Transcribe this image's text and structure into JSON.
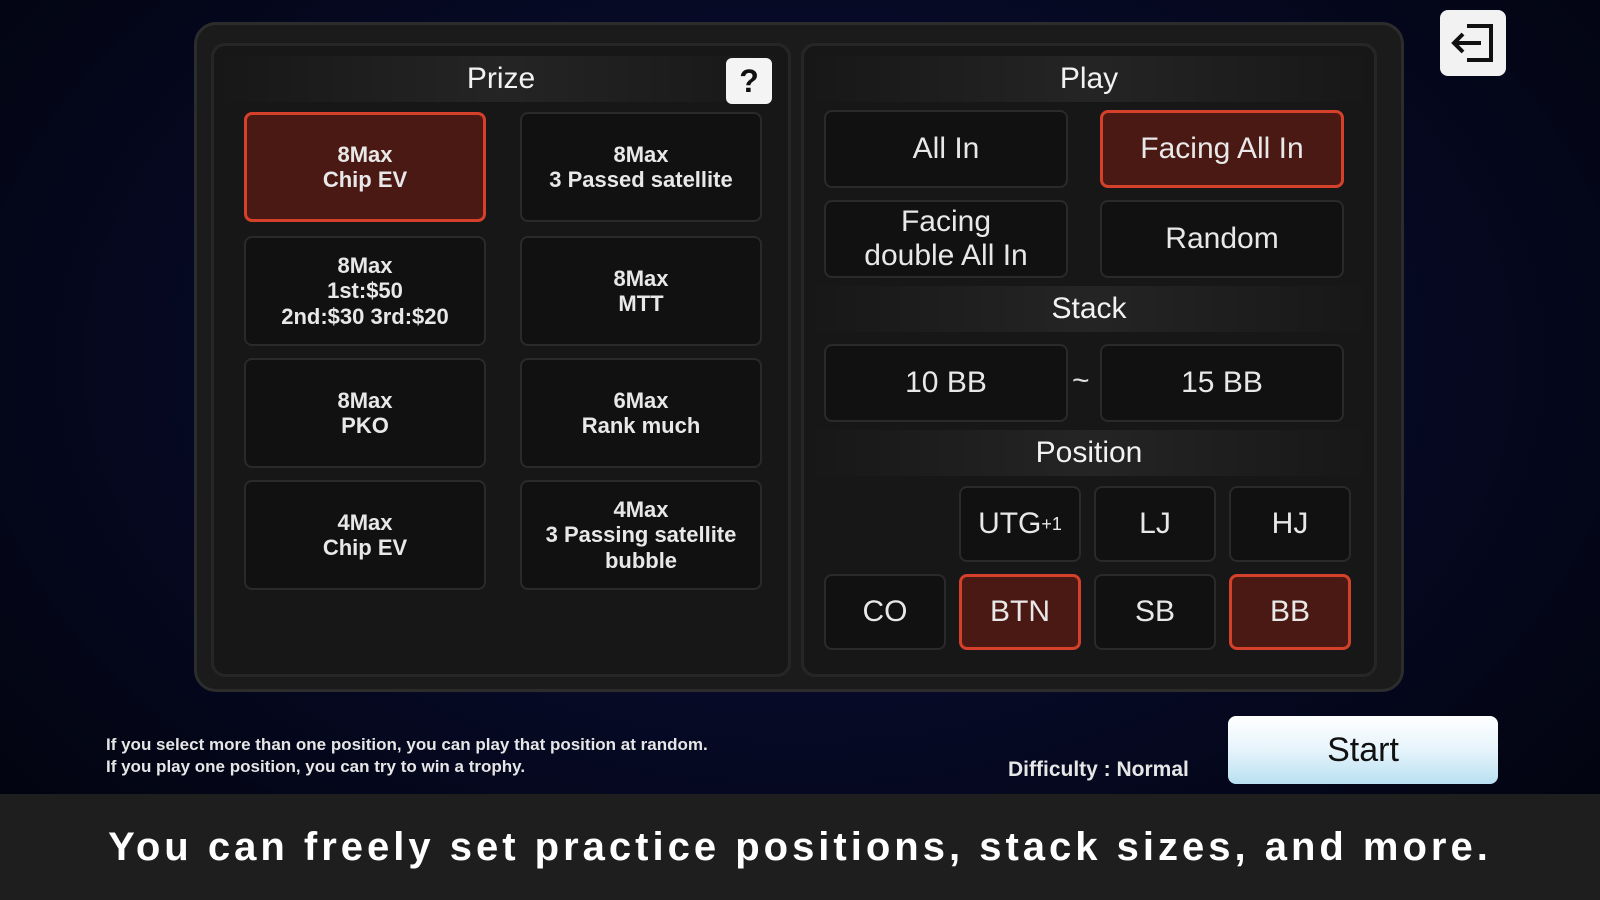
{
  "exit_icon": "exit-door-arrow-icon",
  "prize": {
    "title": "Prize",
    "help_label": "?",
    "options": [
      {
        "label": "8Max\nChip EV",
        "selected": true
      },
      {
        "label": "8Max\n3 Passed satellite",
        "selected": false
      },
      {
        "label": "8Max\n1st:$50\n2nd:$30 3rd:$20",
        "selected": false
      },
      {
        "label": "8Max\nMTT",
        "selected": false
      },
      {
        "label": "8Max\nPKO",
        "selected": false
      },
      {
        "label": "6Max\nRank much",
        "selected": false
      },
      {
        "label": "4Max\nChip EV",
        "selected": false
      },
      {
        "label": "4Max\n3 Passing satellite\nbubble",
        "selected": false
      }
    ]
  },
  "play": {
    "title": "Play",
    "options": [
      {
        "label": "All In",
        "selected": false
      },
      {
        "label": "Facing All In",
        "selected": true
      },
      {
        "label": "Facing\ndouble All In",
        "selected": false
      },
      {
        "label": "Random",
        "selected": false
      }
    ]
  },
  "stack": {
    "title": "Stack",
    "min": "10 BB",
    "separator": "~",
    "max": "15 BB"
  },
  "position": {
    "title": "Position",
    "options": [
      {
        "label": "UTG",
        "suffix": "+1",
        "selected": false
      },
      {
        "label": "LJ",
        "selected": false
      },
      {
        "label": "HJ",
        "selected": false
      },
      {
        "label": "CO",
        "selected": false
      },
      {
        "label": "BTN",
        "selected": true
      },
      {
        "label": "SB",
        "selected": false
      },
      {
        "label": "BB",
        "selected": true
      }
    ]
  },
  "note": {
    "line1": "If you select more than one position, you can play that position at random.",
    "line2": "If you play one position, you can try to win a trophy."
  },
  "difficulty": "Difficulty : Normal",
  "start_label": "Start",
  "caption": "You can freely set practice positions, stack sizes, and more.",
  "colors": {
    "selected_fill": "#4a1913",
    "selected_border": "#d4402a",
    "panel_bg": "#171717"
  }
}
